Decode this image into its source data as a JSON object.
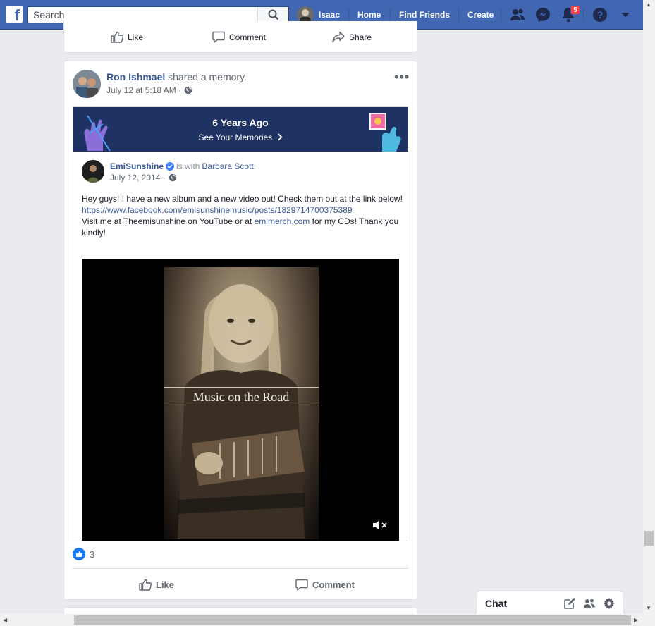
{
  "topbar": {
    "search_placeholder": "Search",
    "user_name": "Isaac",
    "home": "Home",
    "find_friends": "Find Friends",
    "create": "Create",
    "notifications_count": "5"
  },
  "prev_post": {
    "like": "Like",
    "comment": "Comment",
    "share": "Share"
  },
  "post": {
    "author": "Ron Ishmael",
    "action": "shared a memory.",
    "time": "July 12 at 5:18 AM ·",
    "memory": {
      "title": "6 Years Ago",
      "link": "See Your Memories"
    },
    "original": {
      "author": "EmiSunshine",
      "with_text": "is with",
      "tagged": "Barbara Scott.",
      "date": "July 12, 2014 ·",
      "text_line1": "Hey guys! I have a new album and a new video out! Check them out at the link below!",
      "url": "https://www.facebook.com/emisunshinemusic/posts/1829714700375389",
      "text_line2a": "Visit me at Theemisunshine on YouTube or at ",
      "text_link2": "emimerch.com",
      "text_line2b": " for my CDs! Thank you kindly!",
      "video_caption": "Music on the Road"
    },
    "reaction_count": "3",
    "like": "Like",
    "comment": "Comment"
  },
  "chat": {
    "label": "Chat"
  }
}
